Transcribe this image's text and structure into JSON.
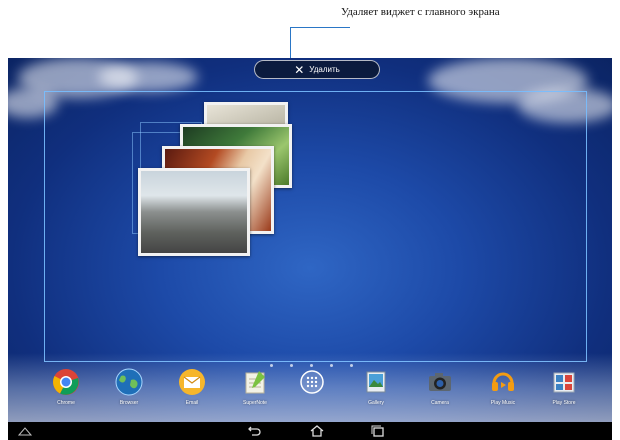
{
  "annotation": {
    "text": "Удаляет виджет с главного экрана"
  },
  "remove_bar": {
    "label": "Удалить",
    "icon": "close-icon"
  },
  "dock": {
    "items": [
      {
        "label": "Chrome",
        "icon": "chrome-icon"
      },
      {
        "label": "Browser",
        "icon": "browser-globe-icon"
      },
      {
        "label": "Email",
        "icon": "email-icon"
      },
      {
        "label": "SuperNote",
        "icon": "supernote-icon"
      },
      {
        "label": "",
        "icon": "app-drawer-icon"
      },
      {
        "label": "Gallery",
        "icon": "gallery-icon"
      },
      {
        "label": "Camera",
        "icon": "camera-icon"
      },
      {
        "label": "Play Music",
        "icon": "play-music-icon"
      },
      {
        "label": "Play Store",
        "icon": "play-store-icon"
      }
    ]
  },
  "navbar": {
    "buttons": [
      "menu-icon",
      "back-icon",
      "home-icon",
      "recent-apps-icon"
    ]
  },
  "colors": {
    "callout": "#2a76c6",
    "frame": "#78beff",
    "navbar": "#000000"
  }
}
